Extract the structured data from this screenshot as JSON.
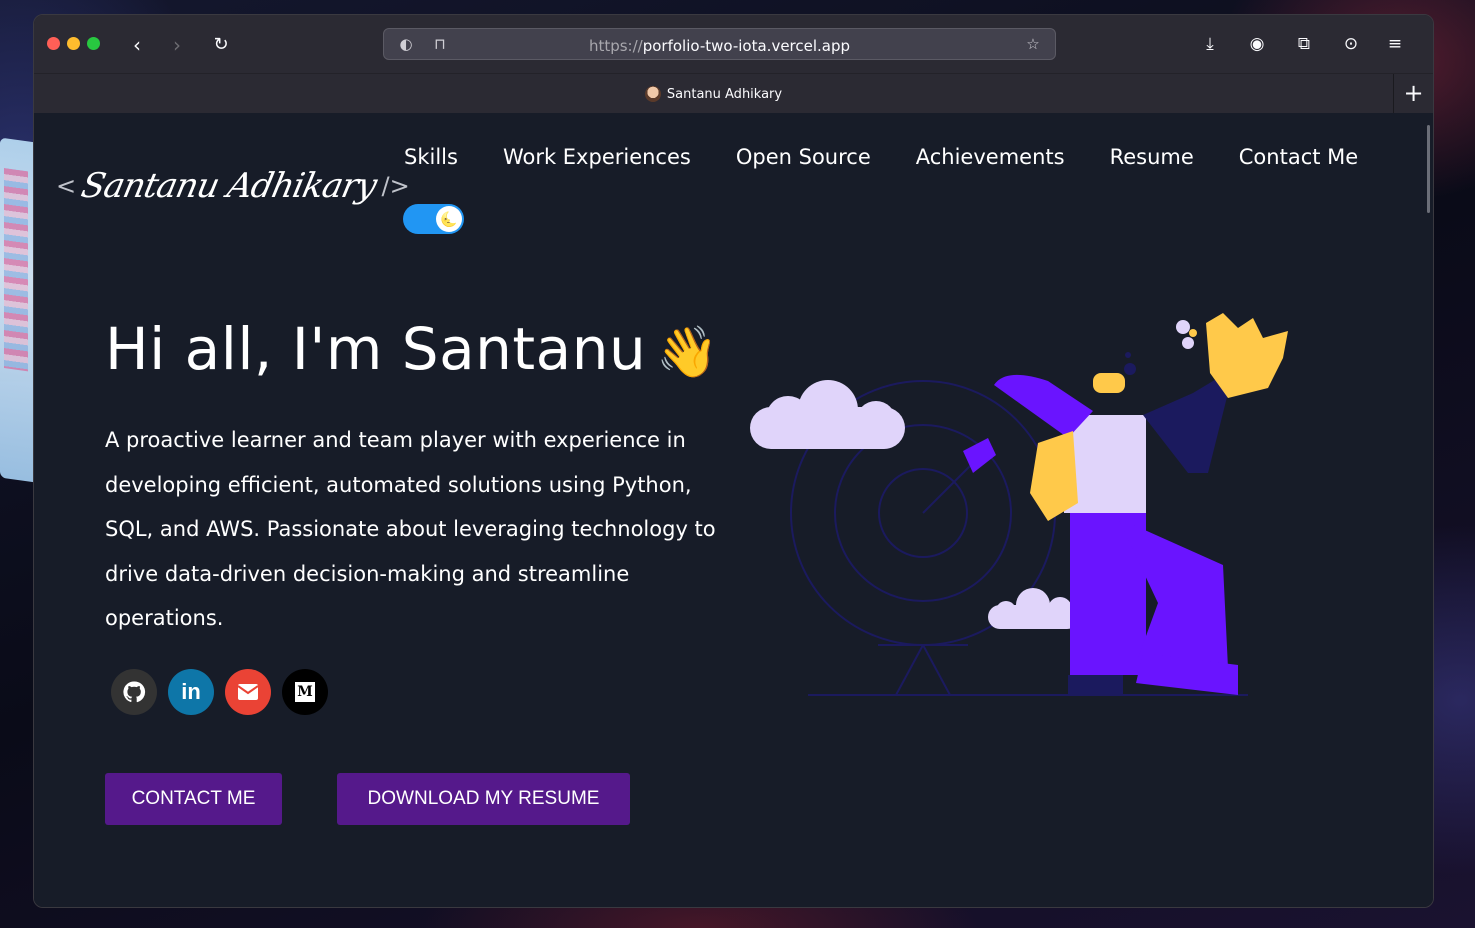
{
  "browser": {
    "url_protocol": "https://",
    "url_host": "porfolio-two-iota.vercel.app",
    "tab_title": "Santanu Adhikary",
    "new_tab_label": "+"
  },
  "site": {
    "logo": {
      "open_bracket": "<",
      "signature": "Santanu Adhikary",
      "close_bracket": "/>"
    },
    "nav": [
      {
        "label": "Skills"
      },
      {
        "label": "Work Experiences"
      },
      {
        "label": "Open Source"
      },
      {
        "label": "Achievements"
      },
      {
        "label": "Resume"
      },
      {
        "label": "Contact Me"
      }
    ],
    "theme_toggle_icon": "🌜",
    "hero": {
      "greeting": "Hi all, I'm Santanu",
      "wave_emoji": "👋",
      "bio": "A proactive learner and team player with experience in developing efficient, automated solutions using Python, SQL, and AWS. Passionate about leveraging technology to drive data-driven decision-making and streamline operations."
    },
    "socials": [
      {
        "icon": "github-icon",
        "glyph": "⬤"
      },
      {
        "icon": "linkedin-icon",
        "glyph": "in"
      },
      {
        "icon": "mail-icon",
        "glyph": "✉"
      },
      {
        "icon": "medium-icon",
        "glyph": "M"
      }
    ],
    "buttons": {
      "contact": "CONTACT ME",
      "resume": "DOWNLOAD MY RESUME"
    }
  },
  "colors": {
    "page_bg": "#171c28",
    "button_bg": "#55198b",
    "toggle_bg": "#2196f3",
    "illustration_purple": "#6a14ff",
    "illustration_lavender": "#e0d4fa",
    "illustration_yellow": "#ffc94a"
  }
}
